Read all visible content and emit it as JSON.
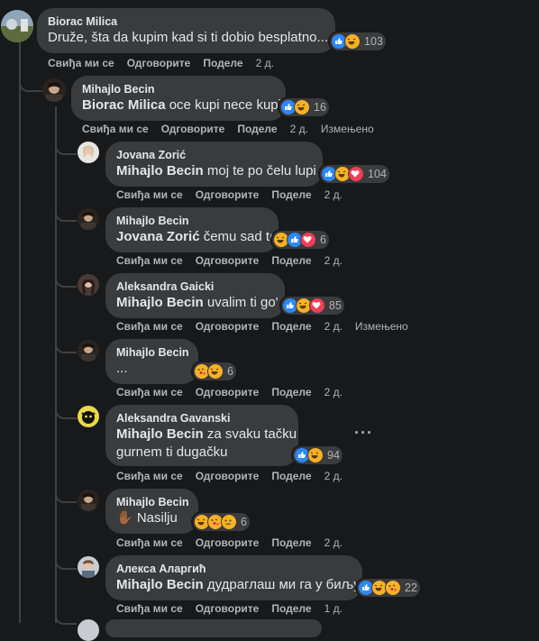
{
  "actions": {
    "like": "Свиђа ми се",
    "reply": "Одговорите",
    "share": "Поделе",
    "edited": "Измењено"
  },
  "colors": {
    "background": "#18191a",
    "bubble": "#3a3b3c",
    "like": "#2d88ff",
    "love": "#f33e58",
    "haha": "#f7b125"
  },
  "comments": [
    {
      "author": "Biorac Milica",
      "mention": "",
      "text": "Druže, šta da kupim kad si ti dobio besplatno...",
      "reactions": [
        "like-icon",
        "haha-icon"
      ],
      "count": "103",
      "time": "2 д.",
      "edited": false
    },
    {
      "author": "Mihajlo Becin",
      "mention": "Biorac Milica",
      "text": " oce kupi nece kupi",
      "reactions": [
        "like-icon",
        "haha-icon"
      ],
      "count": "16",
      "time": "2 д.",
      "edited": true
    },
    {
      "author": "Jovana Zorić",
      "mention": "Mihajlo Becin",
      "text": " moj te po čelu lupi",
      "reactions": [
        "like-icon",
        "haha-icon",
        "love-icon"
      ],
      "count": "104",
      "time": "2 д.",
      "edited": false
    },
    {
      "author": "Mihajlo Becin",
      "mention": "Jovana Zorić",
      "text": " čemu sad to",
      "reactions": [
        "haha-icon",
        "like-icon",
        "love-icon"
      ],
      "count": "6",
      "time": "2 д.",
      "edited": false
    },
    {
      "author": "Aleksandra Gaicki",
      "mention": "Mihajlo Becin",
      "text": " uvalim ti go'",
      "reactions": [
        "like-icon",
        "haha-icon",
        "love-icon"
      ],
      "count": "85",
      "time": "2 д.",
      "edited": true
    },
    {
      "author": "Mihajlo Becin",
      "mention": "",
      "text": "...",
      "reactions": [
        "kiss-icon",
        "haha-icon"
      ],
      "count": "6",
      "time": "2 д.",
      "edited": false
    },
    {
      "author": "Aleksandra Gavanski",
      "mention": "Mihajlo Becin",
      "text": " za svaku tačku",
      "text2": "gurnem ti dugačku",
      "reactions": [
        "like-icon",
        "haha-icon"
      ],
      "count": "94",
      "time": "2 д.",
      "edited": false
    },
    {
      "author": "Mihajlo Becin",
      "mention": "",
      "text": "✋🏾 Nasilju",
      "reactions": [
        "haha-icon",
        "kiss-icon",
        "sad-icon"
      ],
      "count": "6",
      "time": "2 д.",
      "edited": false
    },
    {
      "author": "Алекса Аларгић",
      "mention": "Mihajlo Becin",
      "text": " дудраглаш ми га у биљу",
      "reactions": [
        "like-icon",
        "haha-icon",
        "kiss-icon"
      ],
      "count": "22",
      "time": "1 д.",
      "edited": false
    }
  ],
  "more_icon": "more-options-icon"
}
